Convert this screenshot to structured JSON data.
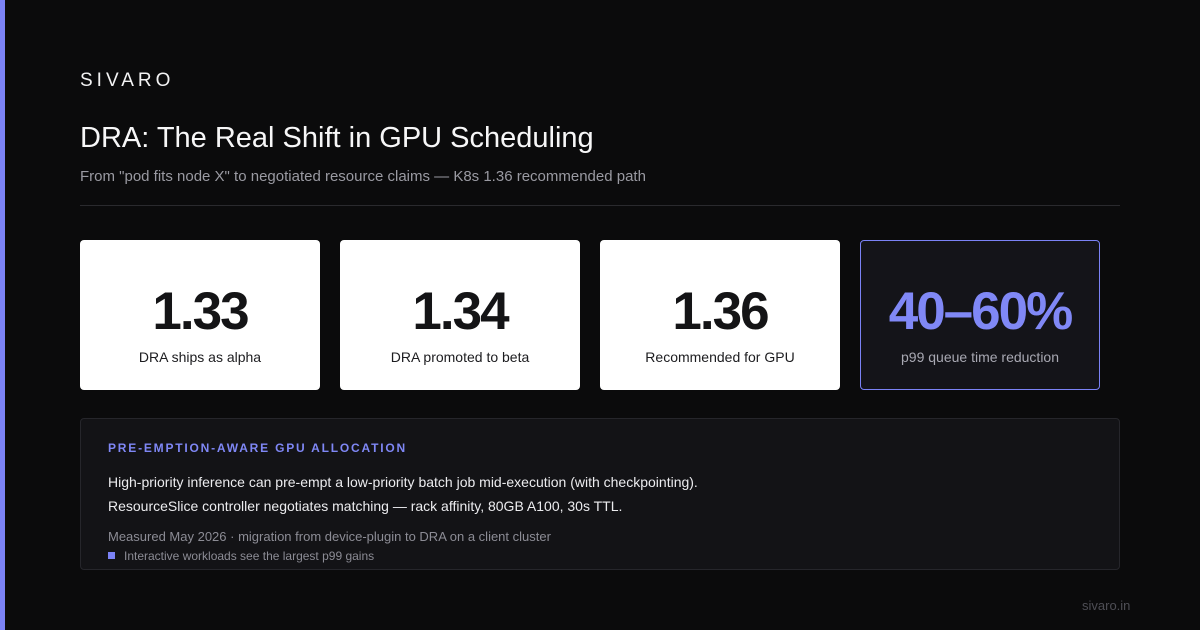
{
  "brand": "SIVARO",
  "title": "DRA: The Real Shift in GPU Scheduling",
  "subtitle": "From \"pod fits node X\" to negotiated resource claims — K8s 1.36 recommended path",
  "stats": [
    {
      "value": "1.33",
      "label": "DRA ships as alpha"
    },
    {
      "value": "1.34",
      "label": "DRA promoted to beta"
    },
    {
      "value": "1.36",
      "label": "Recommended for GPU"
    },
    {
      "value": "40–60%",
      "label": "p99 queue time reduction"
    }
  ],
  "panel": {
    "heading": "PRE-EMPTION-AWARE GPU ALLOCATION",
    "lines": [
      "High-priority inference can pre-empt a low-priority batch job mid-execution (with checkpointing).",
      "ResourceSlice controller negotiates matching — rack affinity, 80GB A100, 30s TTL."
    ],
    "meta": "Measured May 2026 · migration from device-plugin to DRA on a client cluster",
    "note": "Interactive workloads see the largest p99 gains"
  },
  "footer": {
    "url": "sivaro.in"
  },
  "colors": {
    "background": "#0b0b0c",
    "accent": "#7b82f5",
    "card": "#ffffff",
    "panel": "#131316"
  }
}
